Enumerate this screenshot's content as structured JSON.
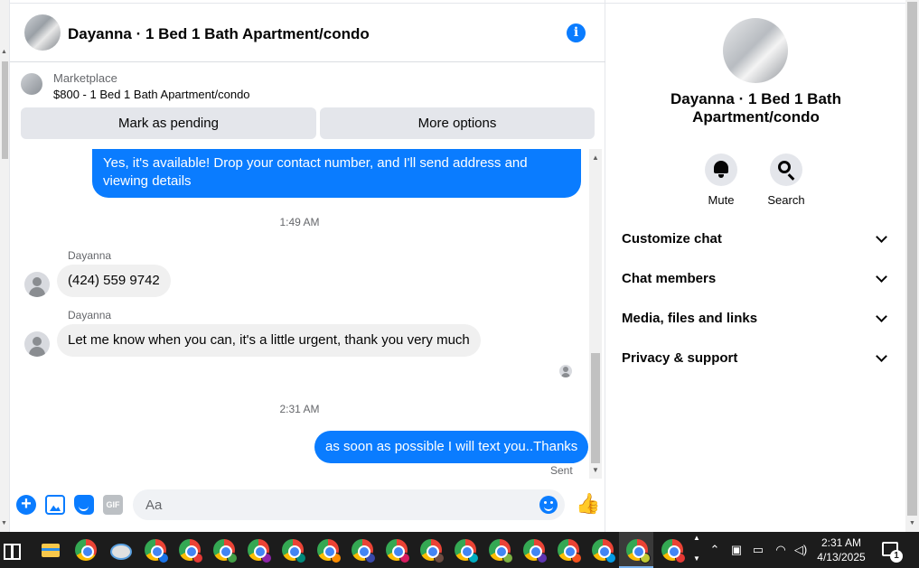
{
  "header": {
    "title": "Dayanna · 1 Bed 1 Bath Apartment/condo"
  },
  "marketplace": {
    "label": "Marketplace",
    "listing": "$800 - 1 Bed 1 Bath Apartment/condo",
    "mark_pending_label": "Mark as pending",
    "more_options_label": "More options"
  },
  "messages": [
    {
      "direction": "outgoing",
      "text": "Yes, it's available! Drop your contact number, and I'll send address and viewing details"
    },
    {
      "type": "timestamp",
      "text": "1:49 AM"
    },
    {
      "direction": "incoming",
      "sender": "Dayanna",
      "text": "(424) 559 9742"
    },
    {
      "direction": "incoming",
      "sender": "Dayanna",
      "text": "Let me know when you can, it's a little urgent, thank you very much"
    },
    {
      "type": "timestamp",
      "text": "2:31 AM"
    },
    {
      "direction": "outgoing",
      "text": "as soon as possible I will text you..Thanks",
      "status": "Sent"
    }
  ],
  "composer": {
    "placeholder": "Aa",
    "gif_label": "GIF"
  },
  "details": {
    "name": "Dayanna · 1 Bed 1 Bath Apartment/condo",
    "actions": [
      {
        "label": "Mute",
        "icon": "bell-icon"
      },
      {
        "label": "Search",
        "icon": "search-icon"
      }
    ],
    "sections": [
      {
        "label": "Customize chat"
      },
      {
        "label": "Chat members"
      },
      {
        "label": "Media, files and links"
      },
      {
        "label": "Privacy & support"
      }
    ]
  },
  "taskbar": {
    "time": "2:31 AM",
    "date": "4/13/2025",
    "notification_count": "1",
    "profile_colors": [
      "#1a73e8",
      "#e53935",
      "#43a047",
      "#8e24aa",
      "#00897b",
      "#fb8c00",
      "#3949ab",
      "#d81b60",
      "#6d4c41",
      "#00acc1",
      "#7cb342",
      "#5e35b1",
      "#f4511e",
      "#039be5",
      "#c0ca33",
      "#e53935"
    ]
  },
  "colors": {
    "accent": "#0a7cff",
    "bubble_in": "#f0f0f0",
    "button_bg": "#e4e6eb"
  }
}
